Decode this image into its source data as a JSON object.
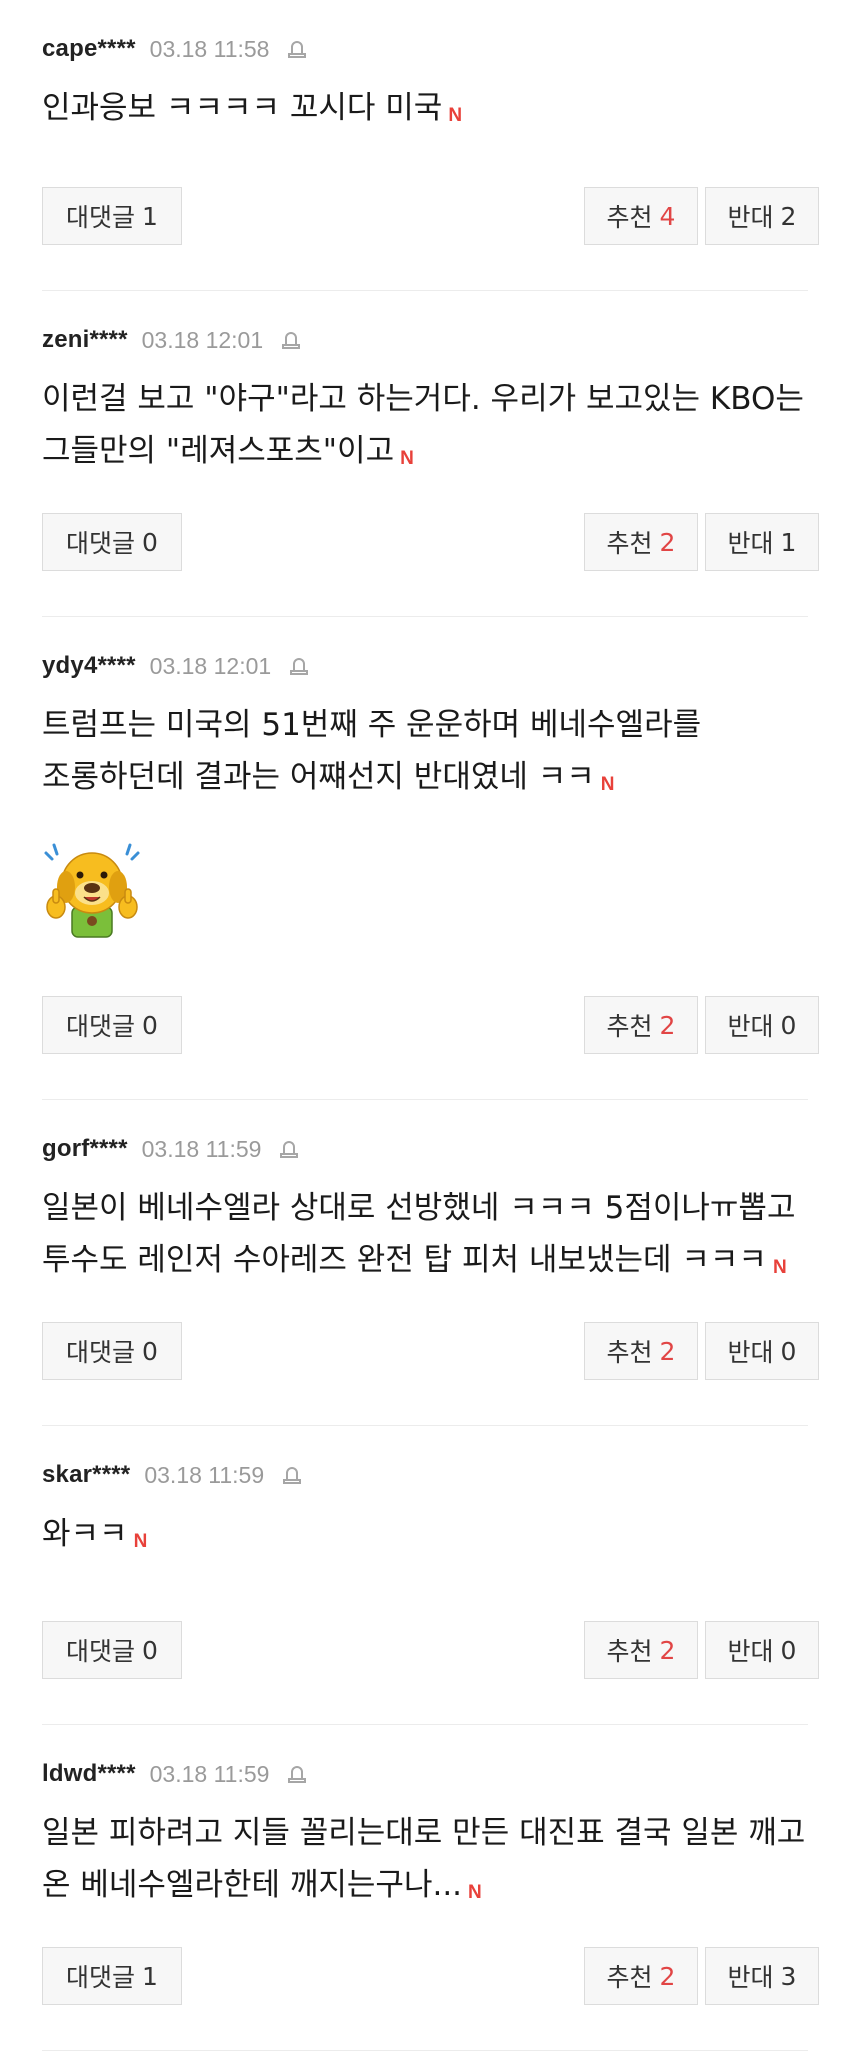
{
  "labels": {
    "reply": "대댓글",
    "like": "추천",
    "dislike": "반대",
    "badge": "N"
  },
  "icons": {
    "report": "siren-icon",
    "emoticon": "dog-thumbs-up-emoticon"
  },
  "colors": {
    "badge": "#e8413a",
    "like_count": "#e14545",
    "timestamp": "#9a9a9a"
  },
  "comments": [
    {
      "user": "cape****",
      "time": "03.18 11:58",
      "text": "인과응보 ㅋㅋㅋㅋ 꼬시다 미국",
      "replies": "1",
      "likes": "4",
      "dislikes": "2"
    },
    {
      "user": "zeni****",
      "time": "03.18 12:01",
      "text": "이런걸 보고 \"야구\"라고 하는거다. 우리가 보고있는 KBO는 그들만의 \"레져스포츠\"이고",
      "replies": "0",
      "likes": "2",
      "dislikes": "1"
    },
    {
      "user": "ydy4****",
      "time": "03.18 12:01",
      "text": "트럼프는 미국의 51번째 주 운운하며 베네수엘라를 조롱하던데 결과는 어쨰선지 반대였네 ㅋㅋ",
      "replies": "0",
      "likes": "2",
      "dislikes": "0",
      "has_emoticon": true
    },
    {
      "user": "gorf****",
      "time": "03.18 11:59",
      "text": "일본이 베네수엘라 상대로 선방했네 ㅋㅋㅋ 5점이나ㅠ뽑고 투수도 레인저 수아레즈 완전 탑 피처 내보냈는데 ㅋㅋㅋ",
      "replies": "0",
      "likes": "2",
      "dislikes": "0"
    },
    {
      "user": "skar****",
      "time": "03.18 11:59",
      "text": "와ㅋㅋ",
      "replies": "0",
      "likes": "2",
      "dislikes": "0"
    },
    {
      "user": "ldwd****",
      "time": "03.18 11:59",
      "text": "일본 피하려고 지들 꼴리는대로 만든 대진표 결국 일본 깨고 온 베네수엘라한테 깨지는구나...",
      "replies": "1",
      "likes": "2",
      "dislikes": "3"
    }
  ]
}
